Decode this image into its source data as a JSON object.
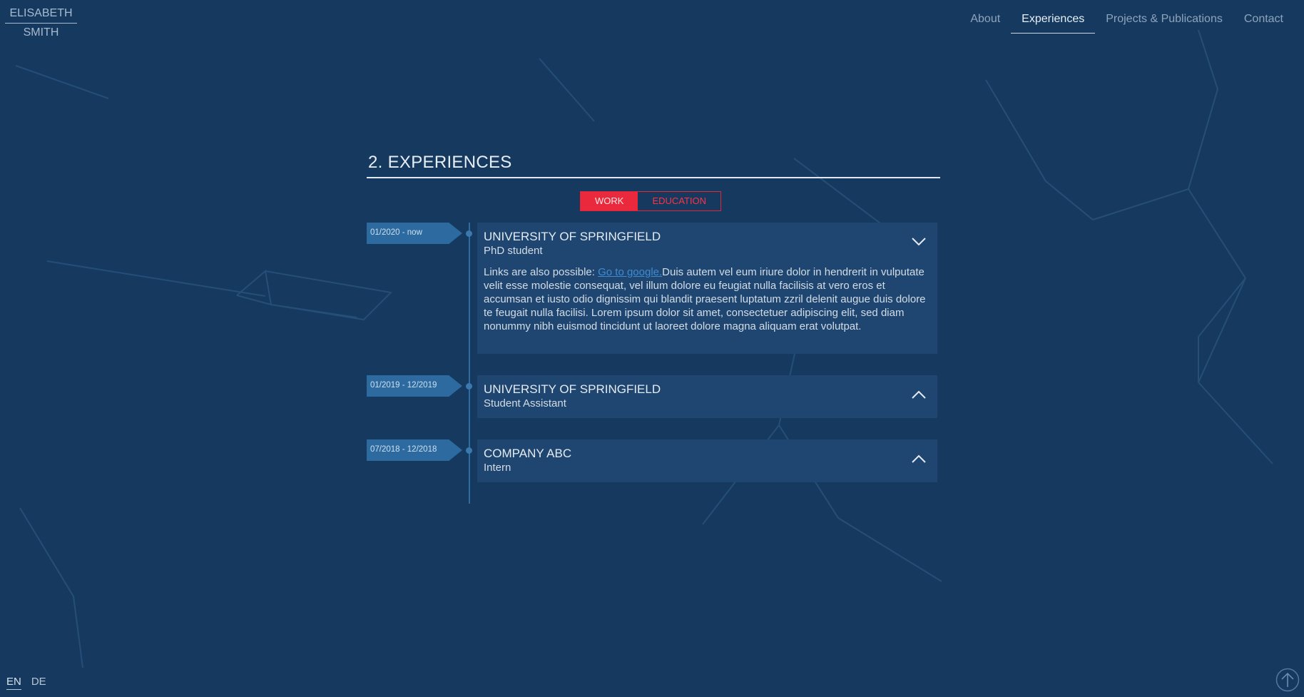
{
  "header": {
    "logo": {
      "first": "ELISABETH",
      "last": "SMITH"
    },
    "nav": [
      {
        "label": "About",
        "active": false
      },
      {
        "label": "Experiences",
        "active": true
      },
      {
        "label": "Projects & Publications",
        "active": false
      },
      {
        "label": "Contact",
        "active": false
      }
    ]
  },
  "section": {
    "title": "2. EXPERIENCES",
    "toggle": {
      "work": "WORK",
      "education": "EDUCATION",
      "selected": "WORK"
    },
    "entries": [
      {
        "date": "01/2020 - now",
        "org": "UNIVERSITY OF SPRINGFIELD",
        "role": "PhD student",
        "expanded": true,
        "desc_prefix": "Links are also possible: ",
        "link_text": "Go to google.",
        "desc_rest": "Duis autem vel eum iriure dolor in hendrerit in vulputate velit esse molestie consequat, vel illum dolore eu feugiat nulla facilisis at vero eros et accumsan et iusto odio dignissim qui blandit praesent luptatum zzril delenit augue duis dolore te feugait nulla facilisi. Lorem ipsum dolor sit amet, consectetuer adipiscing elit, sed diam nonummy nibh euismod tincidunt ut laoreet dolore magna aliquam erat volutpat."
      },
      {
        "date": "01/2019 - 12/2019",
        "org": "UNIVERSITY OF SPRINGFIELD",
        "role": "Student Assistant",
        "expanded": false
      },
      {
        "date": "07/2018 - 12/2018",
        "org": "COMPANY ABC",
        "role": "Intern",
        "expanded": false
      }
    ]
  },
  "footer": {
    "languages": [
      {
        "code": "EN",
        "active": true
      },
      {
        "code": "DE",
        "active": false
      }
    ],
    "scroll_top_icon": "arrow-up-circle-icon"
  },
  "colors": {
    "background": "#163a5f",
    "card": "#1f4670",
    "accent_red": "#ea2a3c",
    "date_tag": "#2c6aa0",
    "link": "#3f8bd1"
  }
}
